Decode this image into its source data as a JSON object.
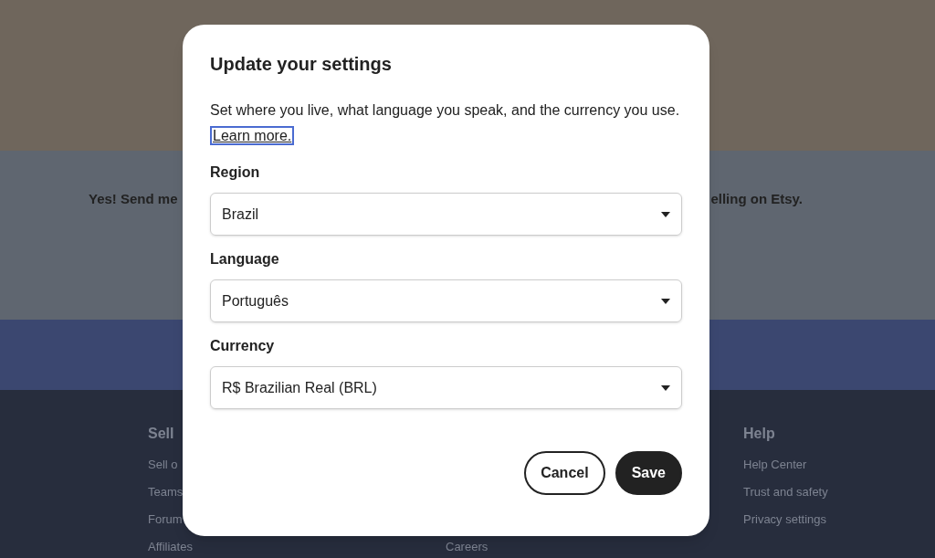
{
  "background": {
    "signup_left": "Yes! Send me",
    "signup_right": "elling on Etsy.",
    "footer_columns": [
      {
        "heading": "Sell",
        "links": [
          "Sell o",
          "Teams",
          "Forum",
          "Affiliates"
        ]
      },
      {
        "links": [
          "Careers"
        ]
      },
      {
        "heading": "Help",
        "links": [
          "Help Center",
          "Trust and safety",
          "Privacy settings"
        ]
      }
    ]
  },
  "dialog": {
    "title": "Update your settings",
    "description": "Set where you live, what language you speak, and the currency you use.",
    "link": "Learn more.",
    "fields": [
      {
        "label": "Region",
        "value": "Brazil"
      },
      {
        "label": "Language",
        "value": "Português"
      },
      {
        "label": "Currency",
        "value": "R$ Brazilian Real (BRL)"
      }
    ],
    "buttons": [
      {
        "label": "Cancel",
        "kind": "secondary"
      },
      {
        "label": "Save",
        "kind": "primary"
      }
    ]
  }
}
